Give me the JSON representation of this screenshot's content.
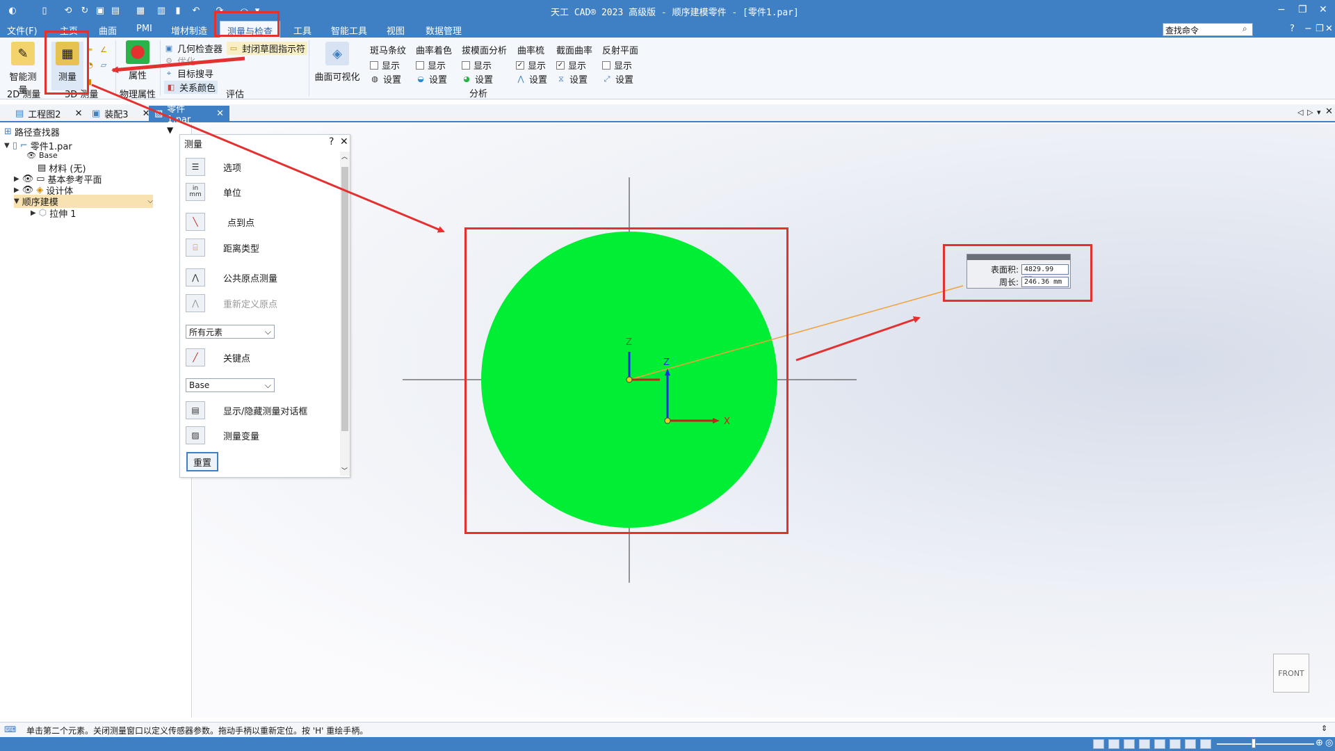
{
  "app_title": "天工 CAD® 2023 高级版 - 顺序建模零件 - [零件1.par]",
  "menu": {
    "file": "文件(F)",
    "tabs": [
      "主页",
      "曲面",
      "PMI",
      "增材制造",
      "测量与检查",
      "工具",
      "智能工具",
      "视图",
      "数据管理"
    ],
    "active_tab": "测量与检查",
    "search_label": "查找命令"
  },
  "ribbon": {
    "smart_measure": "智能测量",
    "measure": "测量",
    "group_2d": "2D 测量",
    "group_3d": "3D 测量",
    "properties": "属性",
    "group_physical": "物理属性",
    "geo_inspector": "几何检查器",
    "closed_sketch": "封闭草图指示符",
    "optimize": "优化",
    "target_finder": "目标搜寻",
    "relation_color": "关系颜色",
    "group_evaluate": "评估",
    "surface_vis": "曲面可视化",
    "analysis_group": "分析",
    "analysis_cols": [
      {
        "title": "斑马条纹",
        "show": "显示",
        "setting": "设置",
        "checked": false
      },
      {
        "title": "曲率着色",
        "show": "显示",
        "setting": "设置",
        "checked": false
      },
      {
        "title": "拔模面分析",
        "show": "显示",
        "setting": "设置",
        "checked": false
      },
      {
        "title": "曲率梳",
        "show": "显示",
        "setting": "设置",
        "checked": true
      },
      {
        "title": "截面曲率",
        "show": "显示",
        "setting": "设置",
        "checked": true
      },
      {
        "title": "反射平面",
        "show": "显示",
        "setting": "设置",
        "checked": false
      }
    ]
  },
  "doc_tabs": [
    "工程图2",
    "装配3",
    "零件1.par"
  ],
  "pathfinder": {
    "title": "路径查找器",
    "root": "零件1.par",
    "items": [
      "Base",
      "材料 (无)",
      "基本参考平面",
      "设计体",
      "顺序建模",
      "拉伸 1"
    ]
  },
  "measure_panel": {
    "title": "测量",
    "help": "?",
    "items": [
      "选项",
      "单位",
      "点到点",
      "距离类型",
      "公共原点测量",
      "重新定义原点"
    ],
    "filter_select": "所有元素",
    "keypoint": "关键点",
    "plane_select": "Base",
    "items2": [
      "显示/隐藏测量对话框",
      "测量变量"
    ],
    "reset": "重置"
  },
  "callout": {
    "area_label": "表面积:",
    "area_value": "4829.99 mm",
    "perimeter_label": "周长:",
    "perimeter_value": "246.36 mm"
  },
  "axes": {
    "z1": "Z",
    "z2": "Z",
    "x2": "X"
  },
  "view_cube": "FRONT",
  "status_text": "单击第二个元素。关闭测量窗口以定义传感器参数。拖动手柄以重新定位。按 'H' 重绘手柄。",
  "colors": {
    "accent": "#3f7fc3",
    "circle": "#00ee33",
    "annotation_red": "#e53030"
  }
}
